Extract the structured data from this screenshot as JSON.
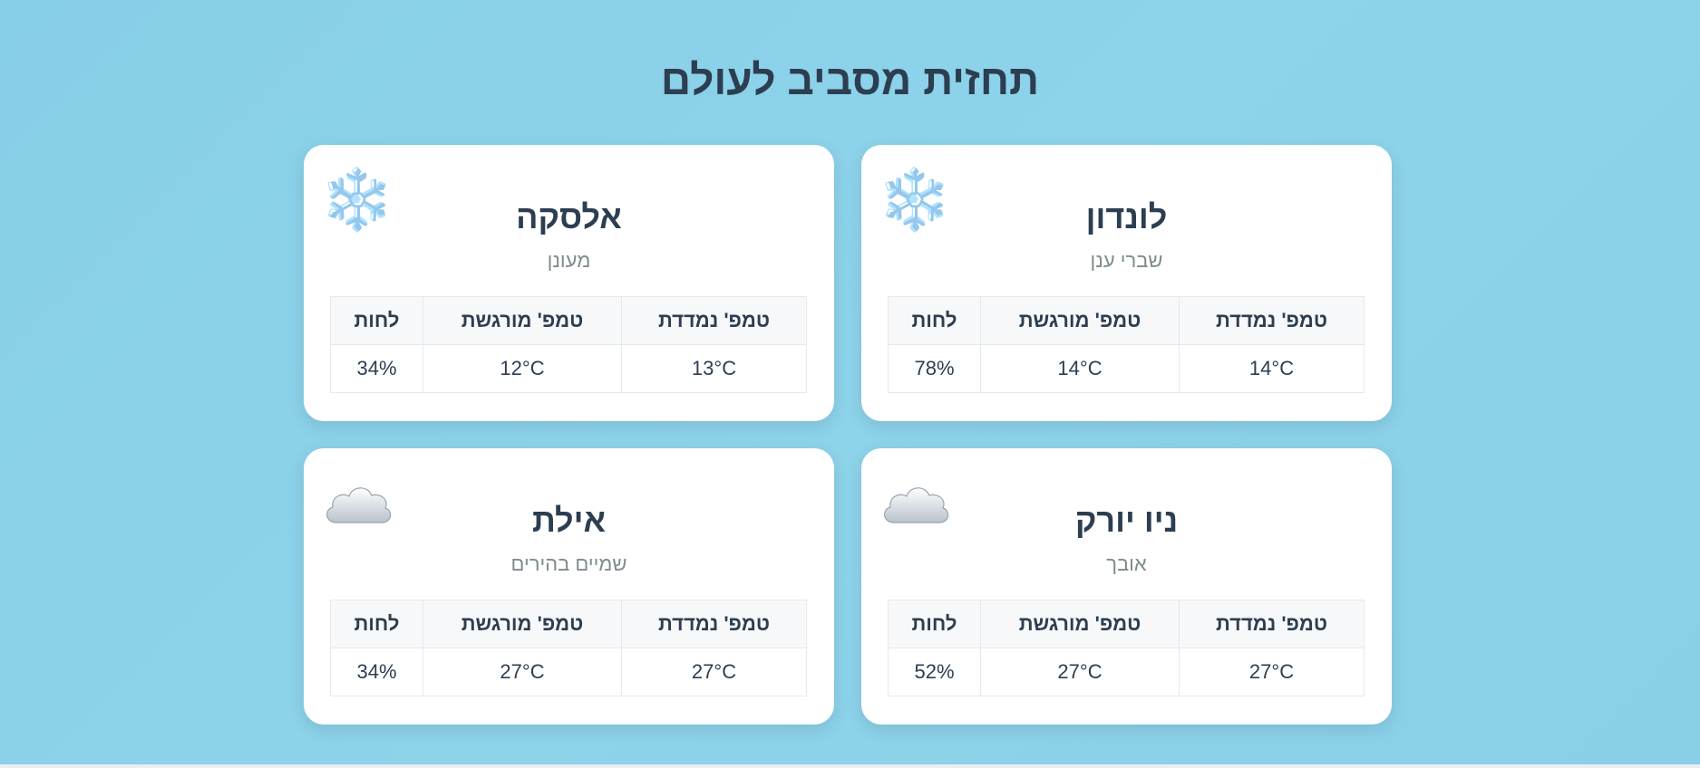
{
  "page": {
    "title": "תחזית מסביב לעולם"
  },
  "table_headers": {
    "measured": "טמפ' נמדדת",
    "feels": "טמפ' מורגשת",
    "humidity": "לחות"
  },
  "cards": [
    {
      "city": "לונדון",
      "condition": "שברי ענן",
      "icon": "snowflake-icon",
      "icon_glyph": "❄️",
      "measured": "14°C",
      "feels": "14°C",
      "humidity": "78%"
    },
    {
      "city": "אלסקה",
      "condition": "מעונן",
      "icon": "snowflake-icon",
      "icon_glyph": "❄️",
      "measured": "13°C",
      "feels": "12°C",
      "humidity": "34%"
    },
    {
      "city": "ניו יורק",
      "condition": "אובך",
      "icon": "cloud-icon",
      "measured": "27°C",
      "feels": "27°C",
      "humidity": "52%"
    },
    {
      "city": "אילת",
      "condition": "שמיים בהירים",
      "icon": "cloud-icon",
      "measured": "27°C",
      "feels": "27°C",
      "humidity": "34%"
    }
  ],
  "colors": {
    "background": "#8dd3ea",
    "card": "#ffffff",
    "text": "#2c3e50",
    "muted": "#7f8c8d"
  }
}
